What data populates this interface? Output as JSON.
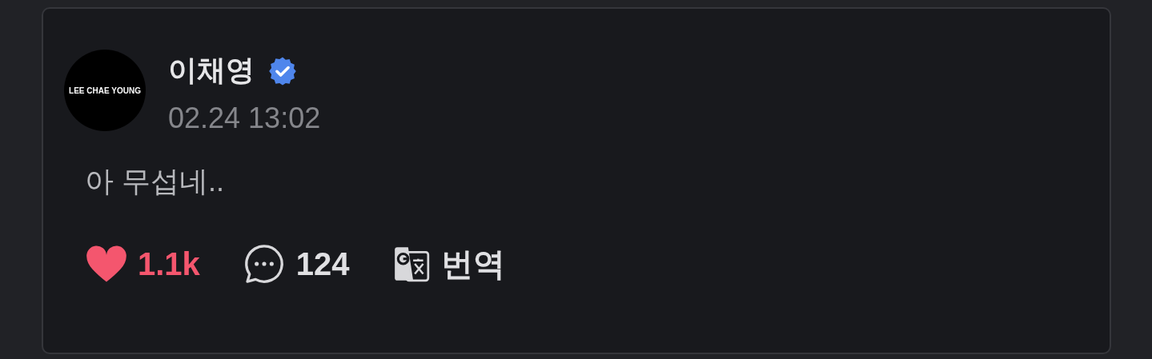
{
  "post": {
    "author": {
      "name": "이채영",
      "verified": true,
      "avatar_text": "LEE CHAE YOUNG"
    },
    "time": "02.24 13:02",
    "text": "아 무섭네..",
    "actions": [
      {
        "kind": "like",
        "label": "1.1k",
        "selected": true
      },
      {
        "kind": "comment",
        "label": "124"
      },
      {
        "kind": "translate",
        "label": "번역"
      }
    ]
  }
}
